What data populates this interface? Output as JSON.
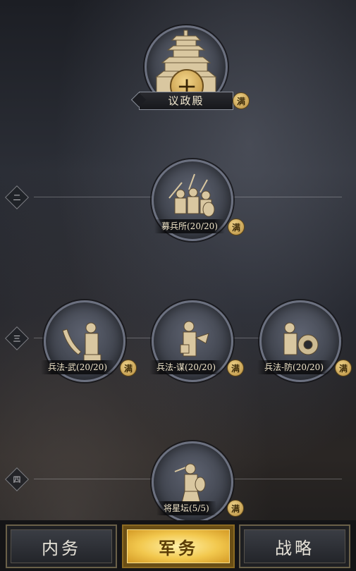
{
  "hall": {
    "label": "议政殿",
    "level": "十",
    "full_badge": "满"
  },
  "tiers": [
    {
      "marker": "二"
    },
    {
      "marker": "三"
    },
    {
      "marker": "四"
    }
  ],
  "nodes": {
    "recruit": {
      "label": "募兵所(20/20)",
      "badge": "满"
    },
    "martial": {
      "label": "兵法-武(20/20)",
      "badge": "满"
    },
    "strategy": {
      "label": "兵法-谋(20/20)",
      "badge": "满"
    },
    "defense": {
      "label": "兵法-防(20/20)",
      "badge": "满"
    },
    "general_altar": {
      "label": "将星坛(5/5)",
      "badge": "满"
    }
  },
  "tabs": [
    {
      "label": "内务",
      "active": false
    },
    {
      "label": "军务",
      "active": true
    },
    {
      "label": "战略",
      "active": false
    }
  ],
  "colors": {
    "gold": "#f2c84e",
    "badge": "#c99b45",
    "node": "#4a4e59"
  }
}
